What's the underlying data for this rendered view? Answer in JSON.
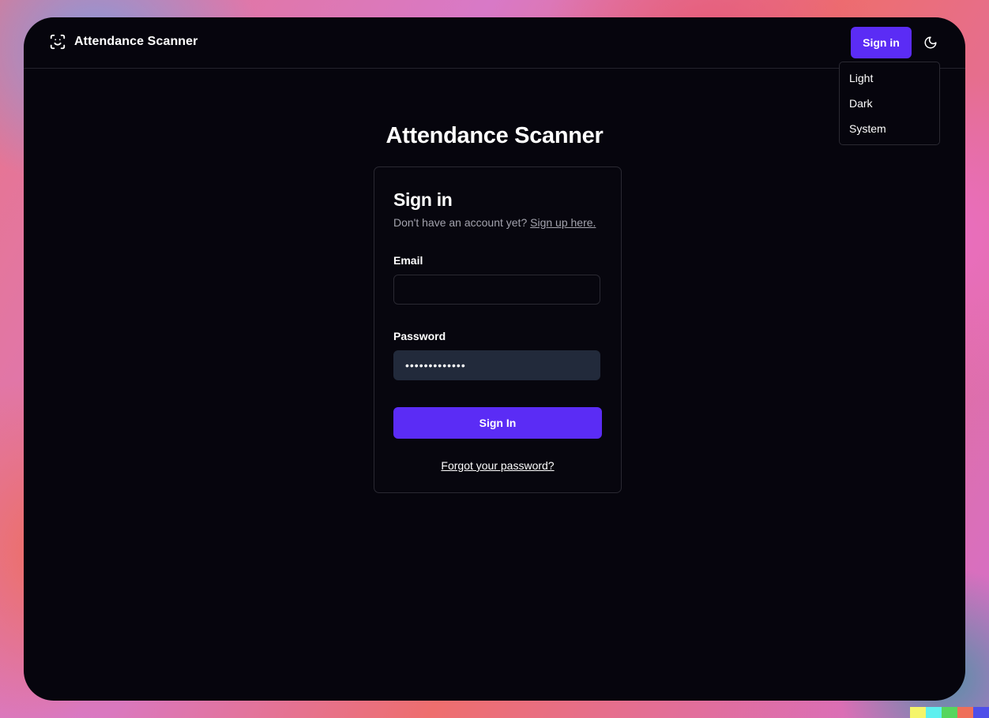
{
  "app": {
    "title": "Attendance Scanner"
  },
  "header": {
    "signin_label": "Sign in"
  },
  "theme_menu": {
    "items": [
      "Light",
      "Dark",
      "System"
    ]
  },
  "main": {
    "heading": "Attendance Scanner"
  },
  "form": {
    "title": "Sign in",
    "subtitle": "Don't have an account yet?",
    "signup_link": "Sign up here.",
    "email_label": "Email",
    "email_value": "",
    "password_label": "Password",
    "password_value": "•••••••••••••",
    "submit_label": "Sign In",
    "forgot_label": "Forgot your password?"
  },
  "colors": {
    "accent": "#5b2cf5",
    "background": "#06050d",
    "password_field": "#222a3b"
  },
  "icons": {
    "brand": "face-scan-icon",
    "theme": "moon-icon"
  },
  "swatch_colors": [
    "#f5f56a",
    "#5ef0ef",
    "#56d65e",
    "#ef6f5a",
    "#4f4fe9"
  ]
}
